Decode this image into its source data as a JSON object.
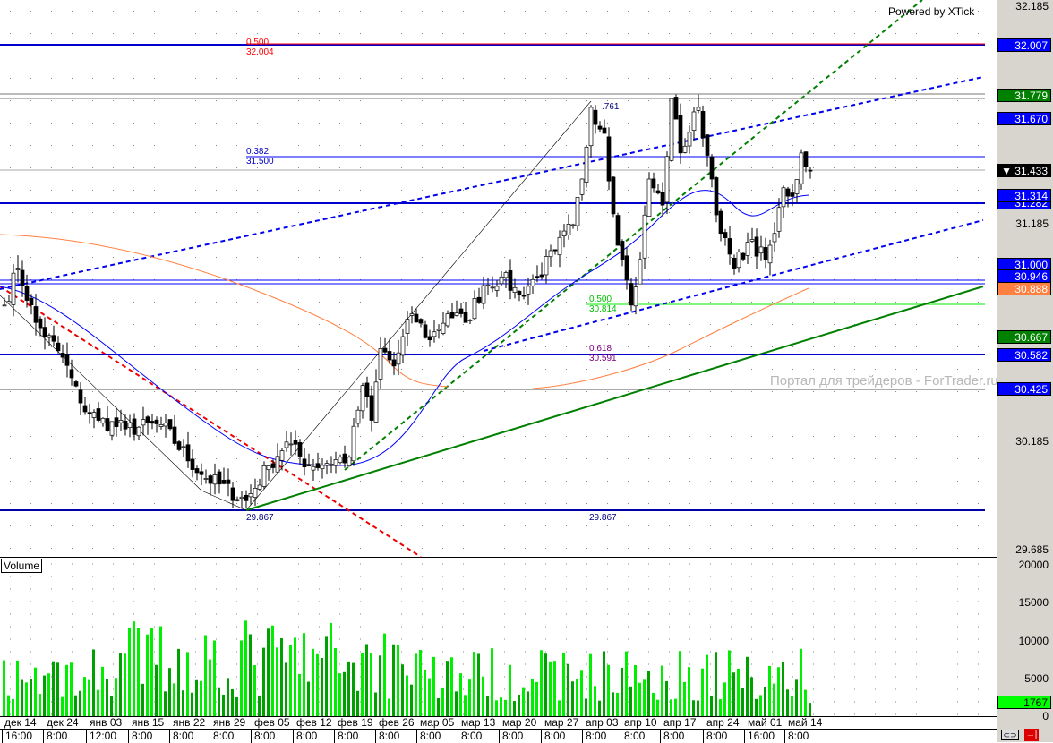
{
  "header": {
    "powered": "Powered by XTick",
    "watermark": "Портал для трейдеров - ForTrader.ru",
    "volume_label": "Volume"
  },
  "price_axis": {
    "ticks": [
      "32.185",
      "31.185",
      "30.185",
      "29.685"
    ],
    "markers": [
      {
        "v": "32.007",
        "price": 32.007,
        "color": "#0000ff"
      },
      {
        "v": "31.779",
        "price": 31.779,
        "color": "#008000"
      },
      {
        "v": "31.670",
        "price": 31.67,
        "color": "#0000ff"
      },
      {
        "v": "31.433",
        "price": 31.433,
        "color": "#000000",
        "prefix": "▼ "
      },
      {
        "v": "31.282",
        "price": 31.282,
        "color": "#0000ff"
      },
      {
        "v": "31.314",
        "price": 31.314,
        "color": "#0000ff"
      },
      {
        "v": "31.000",
        "price": 31.0,
        "color": "#0000ff"
      },
      {
        "v": "30.946",
        "price": 30.946,
        "color": "#0000ff"
      },
      {
        "v": "30.888",
        "price": 30.888,
        "color": "#ff8040"
      },
      {
        "v": "30.667",
        "price": 30.667,
        "color": "#008000"
      },
      {
        "v": "30.582",
        "price": 30.582,
        "color": "#0000ff"
      },
      {
        "v": "30.425",
        "price": 30.425,
        "color": "#0000ff"
      }
    ]
  },
  "volume_axis": {
    "ticks": [
      "20000",
      "15000",
      "10000",
      "5000",
      "0"
    ],
    "current": "1767"
  },
  "fib_labels": [
    {
      "ratio": "0.500",
      "value": "32.004",
      "color": "#ff0000"
    },
    {
      "ratio": "0.382",
      "value": "31.500",
      "color": "#0000c0"
    },
    {
      "ratio": "0.500",
      "value": "30.814",
      "color": "#00c000"
    },
    {
      "ratio": "0.618",
      "value": "30.591",
      "color": "#800080"
    },
    {
      "ratio": "",
      "value": "29.867",
      "color": "#000080"
    },
    {
      "ratio": "",
      "value": "29.867",
      "color": "#000080"
    },
    {
      "ratio": "",
      "value": ".761",
      "color": "#000080"
    }
  ],
  "x_axis": {
    "dates": [
      "дек 14",
      "дек 24",
      "янв 03",
      "янв 15",
      "янв 22",
      "янв 29",
      "фев 05",
      "фев 12",
      "фев 19",
      "фев 26",
      "мар 05",
      "мар 13",
      "мар 20",
      "мар 27",
      "апр 03",
      "апр 10",
      "апр 17",
      "апр 24",
      "май 01",
      "май 14"
    ],
    "times": [
      "16:00",
      "8:00",
      "12:00",
      "8:00",
      "8:00",
      "8:00",
      "8:00",
      "8:00",
      "8:00",
      "8:00",
      "8:00",
      "8:00",
      "8:00",
      "8:00",
      "8:00",
      "8:00",
      "8:00",
      "8:00",
      "16:00",
      "8:00"
    ]
  },
  "chart_data": {
    "type": "candlestick",
    "ylim": [
      29.685,
      32.185
    ],
    "volume_ylim": [
      0,
      20000
    ],
    "close_keypoints": [
      [
        0,
        30.81
      ],
      [
        3,
        30.98
      ],
      [
        7,
        30.73
      ],
      [
        13,
        30.57
      ],
      [
        17,
        30.36
      ],
      [
        21,
        30.28
      ],
      [
        27,
        30.24
      ],
      [
        35,
        30.26
      ],
      [
        44,
        30.03
      ],
      [
        54,
        29.91
      ],
      [
        59,
        30.07
      ],
      [
        63,
        30.18
      ],
      [
        68,
        30.07
      ],
      [
        77,
        30.11
      ],
      [
        80,
        30.44
      ],
      [
        82,
        30.28
      ],
      [
        84,
        30.61
      ],
      [
        87,
        30.53
      ],
      [
        91,
        30.77
      ],
      [
        95,
        30.65
      ],
      [
        99,
        30.77
      ],
      [
        103,
        30.73
      ],
      [
        107,
        30.9
      ],
      [
        111,
        30.94
      ],
      [
        115,
        30.86
      ],
      [
        119,
        30.94
      ],
      [
        123,
        31.06
      ],
      [
        127,
        31.18
      ],
      [
        129,
        31.39
      ],
      [
        131,
        31.72
      ],
      [
        134,
        31.6
      ],
      [
        136,
        31.23
      ],
      [
        138,
        31.02
      ],
      [
        140,
        30.81
      ],
      [
        142,
        31.02
      ],
      [
        144,
        31.39
      ],
      [
        147,
        31.27
      ],
      [
        149,
        31.76
      ],
      [
        151,
        31.51
      ],
      [
        155,
        31.72
      ],
      [
        158,
        31.39
      ],
      [
        160,
        31.14
      ],
      [
        163,
        30.98
      ],
      [
        166,
        31.1
      ],
      [
        170,
        31.02
      ],
      [
        172,
        31.14
      ],
      [
        174,
        31.35
      ],
      [
        176,
        31.31
      ],
      [
        178,
        31.51
      ],
      [
        180,
        31.43
      ]
    ],
    "last_volume": 1767
  }
}
